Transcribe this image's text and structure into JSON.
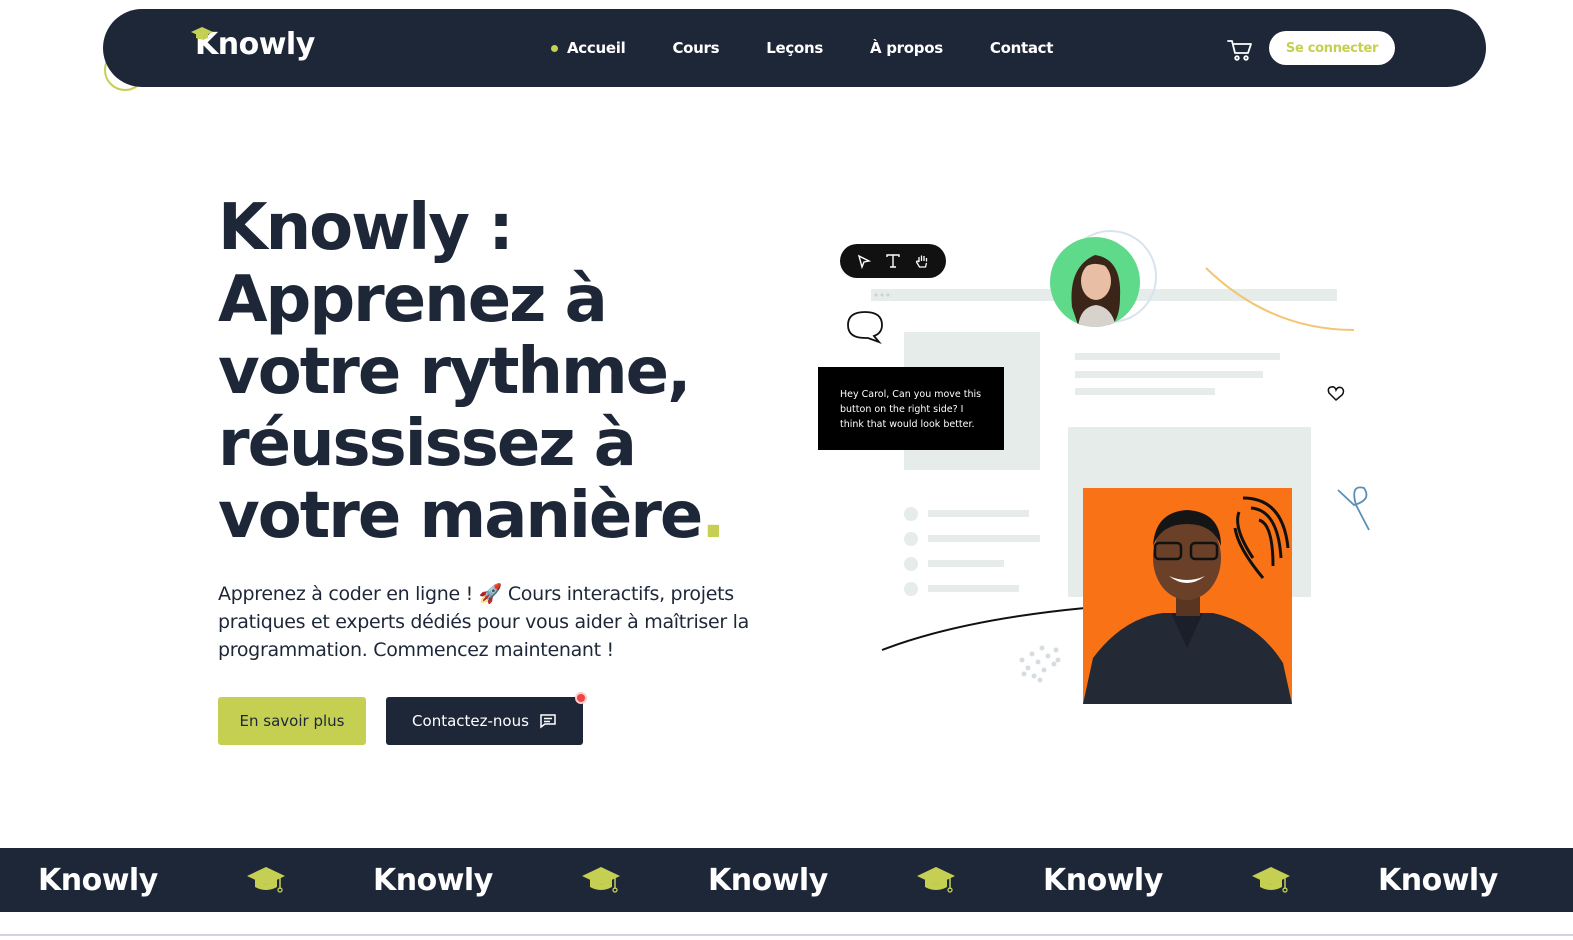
{
  "navbar": {
    "logo": "Knowly",
    "links": [
      "Accueil",
      "Cours",
      "Leçons",
      "À propos",
      "Contact"
    ],
    "active_link": "Accueil",
    "login_label": "Se connecter"
  },
  "hero": {
    "title_line1": "Knowly :",
    "title_line2": "Apprenez à",
    "title_line3": "votre rythme,",
    "title_line4": "réussissez à",
    "title_line5": "votre manière",
    "title_dot": ".",
    "description": "Apprenez à coder en ligne ! 🚀 Cours interactifs, projets pratiques et experts dédiés pour vous aider à maîtriser la programmation. Commencez maintenant !",
    "btn_more": "En savoir plus",
    "btn_contact": "Contactez-nous"
  },
  "illustration": {
    "chat_message": "Hey Carol, Can you move this button on the right side? I think that would look better."
  },
  "banner": {
    "items": [
      "Knowly",
      "Knowly",
      "Knowly",
      "Knowly",
      "Knowly"
    ]
  },
  "colors": {
    "navy": "#1e2738",
    "accent": "#c5cf52",
    "orange": "#f97316",
    "notification": "#ef4444"
  },
  "icons": [
    "graduation-cap-icon",
    "cart-icon",
    "message-icon",
    "cursor-icon",
    "text-tool-icon",
    "hand-icon",
    "speech-bubble-icon",
    "heart-icon"
  ]
}
